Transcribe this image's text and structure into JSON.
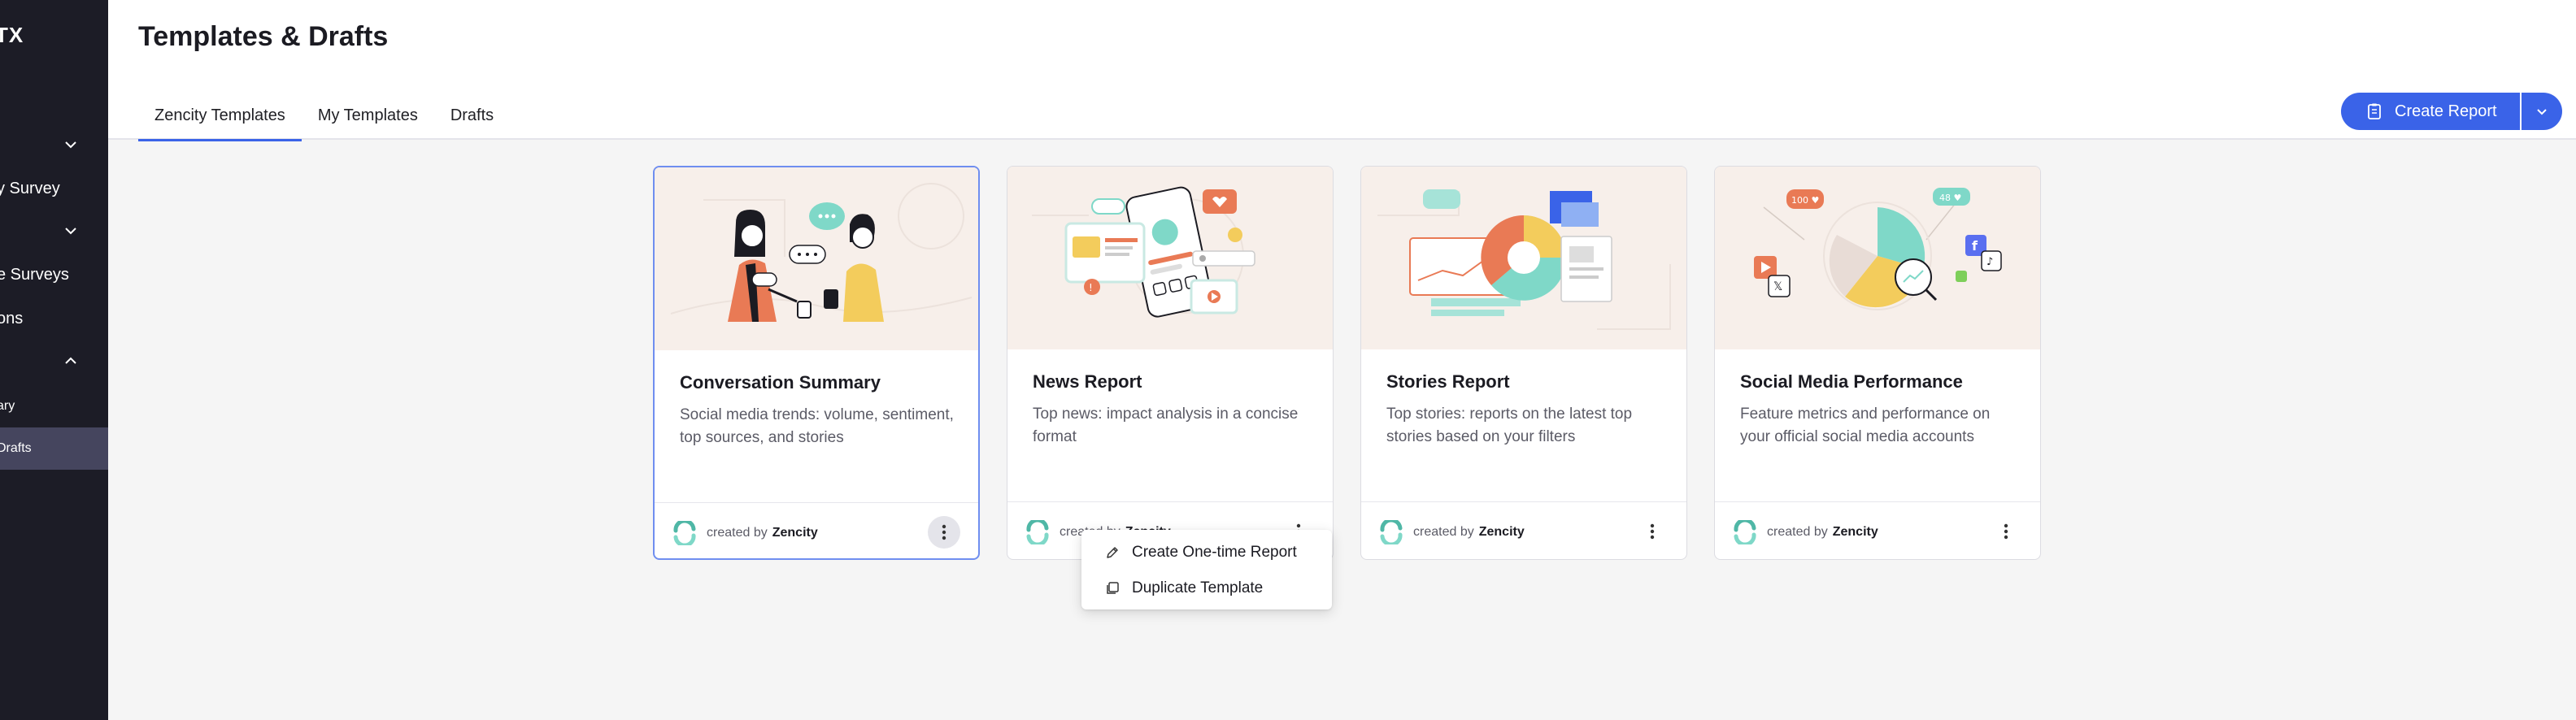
{
  "sidebar": {
    "logo": "TX",
    "items": [
      {
        "label": ""
      },
      {
        "label": "y Survey"
      },
      {
        "label": ""
      },
      {
        "label": "e Surveys"
      },
      {
        "label": "ons"
      },
      {
        "label": ""
      },
      {
        "label": "ary"
      },
      {
        "label": "Drafts"
      }
    ]
  },
  "header": {
    "title": "Templates & Drafts",
    "tabs": [
      {
        "label": "Zencity Templates"
      },
      {
        "label": "My Templates"
      },
      {
        "label": "Drafts"
      }
    ],
    "create_label": "Create Report"
  },
  "cards": [
    {
      "title": "Conversation Summary",
      "description": "Social media trends: volume, sentiment, top sources, and stories",
      "created_by_prefix": "created by",
      "created_by": "Zencity"
    },
    {
      "title": "News Report",
      "description": "Top news: impact analysis in a concise format",
      "created_by_prefix": "created by",
      "created_by": "Zencity"
    },
    {
      "title": "Stories Report",
      "description": "Top stories: reports on the latest top stories based on your filters",
      "created_by_prefix": "created by",
      "created_by": "Zencity"
    },
    {
      "title": "Social Media Performance",
      "description": "Feature metrics and performance on your official social media accounts",
      "created_by_prefix": "created by",
      "created_by": "Zencity"
    }
  ],
  "menu": {
    "items": [
      {
        "label": "Create One-time Report",
        "icon": "pencil-icon"
      },
      {
        "label": "Duplicate Template",
        "icon": "duplicate-icon"
      }
    ]
  },
  "illustration_badges": {
    "likes_100": "100 ♥",
    "likes_48": "48 ♥"
  },
  "colors": {
    "accent": "#3a63e8",
    "sidebar": "#1c1c26",
    "sidebar_active": "#45455e",
    "teal": "#5ecfbe",
    "orange": "#e97a55",
    "yellow": "#f3cc5c"
  }
}
